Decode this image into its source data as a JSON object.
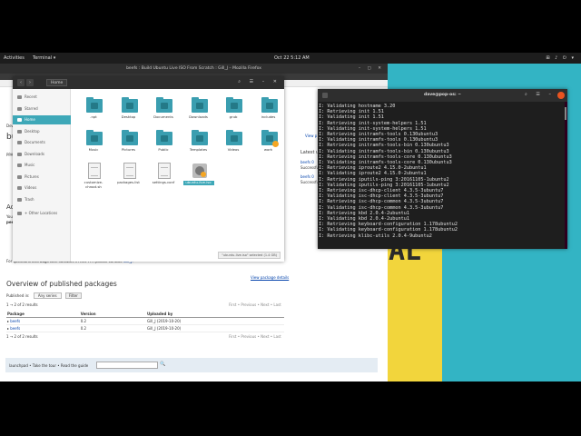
{
  "topbar": {
    "activities": "Activities",
    "app_menu": "Terminal ▾",
    "clock": "Oct 22  5:12 AM",
    "tray": "⊞ ♪ ⏻ ▾"
  },
  "wallpaper": {
    "text": "UR\nAL"
  },
  "firefox": {
    "title": "beefs : Build Ubuntu Live ISO From Scratch : Gill_J – Mozilla Firefox",
    "controls": "–  ▢  ✕",
    "side_title": "bu",
    "side_ppa": "PPA",
    "side_dev": "Dev",
    "side_act": "Ac",
    "side_you": "You",
    "side_pee": "pee",
    "right_view": "View p",
    "right_latest": "Latest u",
    "right_beefs1": "beefs 0",
    "right_succ1": "Successfu",
    "right_beefs2": "beefs 0",
    "right_succ2": "Successfu",
    "bugs_text": "For questions and bugs with software in this PPA please contact",
    "bugs_user": "Gill_J.",
    "view_details": "View package details",
    "published_header": "Overview of published packages",
    "published_by_label": "Published in:",
    "series_select": "Any series",
    "filter_button": "Filter",
    "results_top": "1 → 2 of 2 results",
    "pager_top": "First • Previous • Next • Last",
    "table_headers": [
      "Package",
      "Version",
      "Uploaded by"
    ],
    "rows": [
      {
        "package": "beefs",
        "version": "0.2",
        "uploader": "Gill_J (2019-10-20)"
      },
      {
        "package": "beefs",
        "version": "0.2",
        "uploader": "Gill_J (2019-10-20)"
      }
    ],
    "results_bottom": "1 → 2 of 2 results",
    "pager_bottom": "First • Previous • Next • Last",
    "footer_text": "launchpad • Take the tour • Read the guide",
    "footer_search_icon": "🔍"
  },
  "files": {
    "path": "Home",
    "nav_back": "‹",
    "nav_fwd": "›",
    "controls": "⌕ ☰ – ✕",
    "sidebar": [
      {
        "label": "Recent",
        "active": false
      },
      {
        "label": "Starred",
        "active": false
      },
      {
        "label": "Home",
        "active": true
      },
      {
        "label": "Desktop",
        "active": false
      },
      {
        "label": "Documents",
        "active": false
      },
      {
        "label": "Downloads",
        "active": false
      },
      {
        "label": "Music",
        "active": false
      },
      {
        "label": "Pictures",
        "active": false
      },
      {
        "label": "Videos",
        "active": false
      },
      {
        "label": "Trash",
        "active": false
      },
      {
        "label": "+ Other Locations",
        "active": false
      }
    ],
    "items": [
      {
        "label": ".npt",
        "kind": "folder"
      },
      {
        "label": "Desktop",
        "kind": "folder"
      },
      {
        "label": "Documents",
        "kind": "folder"
      },
      {
        "label": "Downloads",
        "kind": "folder"
      },
      {
        "label": "grub",
        "kind": "folder"
      },
      {
        "label": "includes",
        "kind": "folder"
      },
      {
        "label": "Music",
        "kind": "folder"
      },
      {
        "label": "Pictures",
        "kind": "folder"
      },
      {
        "label": "Public",
        "kind": "folder"
      },
      {
        "label": "Templates",
        "kind": "folder"
      },
      {
        "label": "Videos",
        "kind": "folder"
      },
      {
        "label": "work",
        "kind": "folder-locked"
      },
      {
        "label": "customize-chroot.sh",
        "kind": "doc"
      },
      {
        "label": "packages.list",
        "kind": "doc"
      },
      {
        "label": "settings.conf",
        "kind": "doc"
      },
      {
        "label": "ubuntu-live.iso",
        "kind": "iso",
        "selected": true
      }
    ],
    "status": "\"ubuntu-live.iso\" selected (1.4 GB)"
  },
  "terminal": {
    "title": "dave@pop-os: ~",
    "controls": "⌕ ☰ –",
    "lines": [
      "I: Validating hostname 3.20",
      "I: Retrieving init 1.51",
      "I: Validating init 1.51",
      "I: Retrieving init-system-helpers 1.51",
      "I: Validating init-system-helpers 1.51",
      "I: Retrieving initramfs-tools 0.130ubuntu3",
      "I: Validating initramfs-tools 0.130ubuntu3",
      "I: Retrieving initramfs-tools-bin 0.130ubuntu3",
      "I: Validating initramfs-tools-bin 0.130ubuntu3",
      "I: Retrieving initramfs-tools-core 0.130ubuntu3",
      "I: Validating initramfs-tools-core 0.130ubuntu3",
      "I: Retrieving iproute2 4.15.0-2ubuntu1",
      "I: Validating iproute2 4.15.0-2ubuntu1",
      "I: Retrieving iputils-ping 3:20161105-1ubuntu2",
      "I: Validating iputils-ping 3:20161105-1ubuntu2",
      "I: Retrieving isc-dhcp-client 4.3.5-3ubuntu7",
      "I: Validating isc-dhcp-client 4.3.5-3ubuntu7",
      "I: Retrieving isc-dhcp-common 4.3.5-3ubuntu7",
      "I: Validating isc-dhcp-common 4.3.5-3ubuntu7",
      "I: Retrieving kbd 2.0.4-2ubuntu1",
      "I: Validating kbd 2.0.4-2ubuntu1",
      "I: Retrieving keyboard-configuration 1.178ubuntu2",
      "I: Validating keyboard-configuration 1.178ubuntu2",
      "I: Retrieving klibc-utils 2.0.4-9ubuntu2"
    ]
  }
}
